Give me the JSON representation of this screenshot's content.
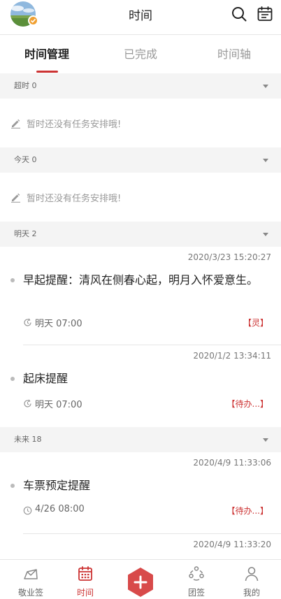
{
  "header": {
    "title": "时间"
  },
  "tabs": [
    {
      "label": "时间管理",
      "active": true
    },
    {
      "label": "已完成",
      "active": false
    },
    {
      "label": "时间轴",
      "active": false
    }
  ],
  "groups": {
    "overdue": {
      "label": "超时 0",
      "empty_text": "暂时还没有任务安排哦!"
    },
    "today": {
      "label": "今天 0",
      "empty_text": "暂时还没有任务安排哦!"
    },
    "tomorrow": {
      "label": "明天 2",
      "tasks": [
        {
          "stamp": "2020/3/23 15:20:27",
          "title": "早起提醒：清风在侧春心起，明月入怀爱意生。",
          "time": "明天 07:00",
          "tag": "【灵】",
          "icon": "repeat-clock-icon"
        },
        {
          "stamp": "2020/1/2 13:34:11",
          "title": "起床提醒",
          "time": "明天 07:00",
          "tag": "【待办...】",
          "icon": "repeat-clock-icon"
        }
      ]
    },
    "future": {
      "label": "未来 18",
      "tasks": [
        {
          "stamp": "2020/4/9 11:33:06",
          "title": "车票预定提醒",
          "time": "4/26 08:00",
          "tag": "【待办...】",
          "icon": "clock-icon"
        },
        {
          "stamp": "2020/4/9 11:33:20"
        }
      ]
    }
  },
  "bottom_nav": [
    {
      "label": "敬业签",
      "icon": "note-icon",
      "active": false
    },
    {
      "label": "时间",
      "icon": "calendar-grid-icon",
      "active": true
    },
    {
      "label": "团签",
      "icon": "team-icon",
      "active": false
    },
    {
      "label": "我的",
      "icon": "person-icon",
      "active": false
    }
  ],
  "colors": {
    "accent": "#cc3333",
    "group_bg": "#f4f4f4",
    "badge": "#f0a032"
  }
}
